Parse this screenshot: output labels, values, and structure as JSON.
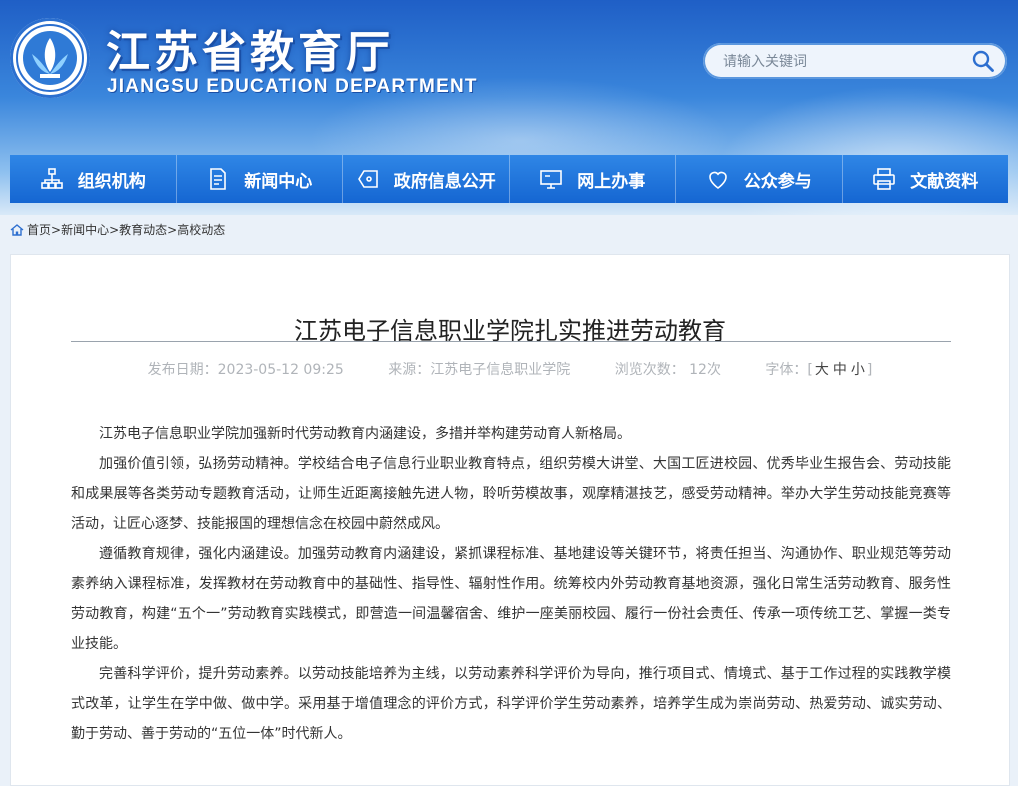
{
  "header": {
    "title": "江苏省教育厅",
    "subtitle": "JIANGSU EDUCATION DEPARTMENT",
    "search_placeholder": "请输入关键词"
  },
  "nav": [
    {
      "label": "组织机构",
      "icon": "org-chart-icon"
    },
    {
      "label": "新闻中心",
      "icon": "document-icon"
    },
    {
      "label": "政府信息公开",
      "icon": "tag-icon"
    },
    {
      "label": "网上办事",
      "icon": "monitor-icon"
    },
    {
      "label": "公众参与",
      "icon": "heart-icon"
    },
    {
      "label": "文献资料",
      "icon": "printer-icon"
    }
  ],
  "breadcrumb": [
    "首页",
    "新闻中心",
    "教育动态",
    "高校动态"
  ],
  "breadcrumb_sep": ">",
  "article": {
    "title": "江苏电子信息职业学院扎实推进劳动教育",
    "publish_date": "发布日期：2023-05-12 09:25",
    "source": "来源：江苏电子信息职业学院",
    "views": "浏览次数： 12次",
    "font_label": "字体：",
    "font_open": "[",
    "font_close": "]",
    "font_large": "大",
    "font_medium": "中",
    "font_small": "小",
    "paragraphs": [
      "江苏电子信息职业学院加强新时代劳动教育内涵建设，多措并举构建劳动育人新格局。",
      "加强价值引领，弘扬劳动精神。学校结合电子信息行业职业教育特点，组织劳模大讲堂、大国工匠进校园、优秀毕业生报告会、劳动技能和成果展等各类劳动专题教育活动，让师生近距离接触先进人物，聆听劳模故事，观摩精湛技艺，感受劳动精神。举办大学生劳动技能竞赛等活动，让匠心逐梦、技能报国的理想信念在校园中蔚然成风。",
      "遵循教育规律，强化内涵建设。加强劳动教育内涵建设，紧抓课程标准、基地建设等关键环节，将责任担当、沟通协作、职业规范等劳动素养纳入课程标准，发挥教材在劳动教育中的基础性、指导性、辐射性作用。统筹校内外劳动教育基地资源，强化日常生活劳动教育、服务性劳动教育，构建“五个一”劳动教育实践模式，即营造一间温馨宿舍、维护一座美丽校园、履行一份社会责任、传承一项传统工艺、掌握一类专业技能。",
      "完善科学评价，提升劳动素养。以劳动技能培养为主线，以劳动素养科学评价为导向，推行项目式、情境式、基于工作过程的实践教学模式改革，让学生在学中做、做中学。采用基于增值理念的评价方式，科学评价学生劳动素养，培养学生成为崇尚劳动、热爱劳动、诚实劳动、勤于劳动、善于劳动的“五位一体”时代新人。"
    ]
  },
  "colors": {
    "nav_bg": "#1a6fd8",
    "banner_top": "#1f5fc6",
    "text": "#333333",
    "meta": "#b0b4b9"
  }
}
